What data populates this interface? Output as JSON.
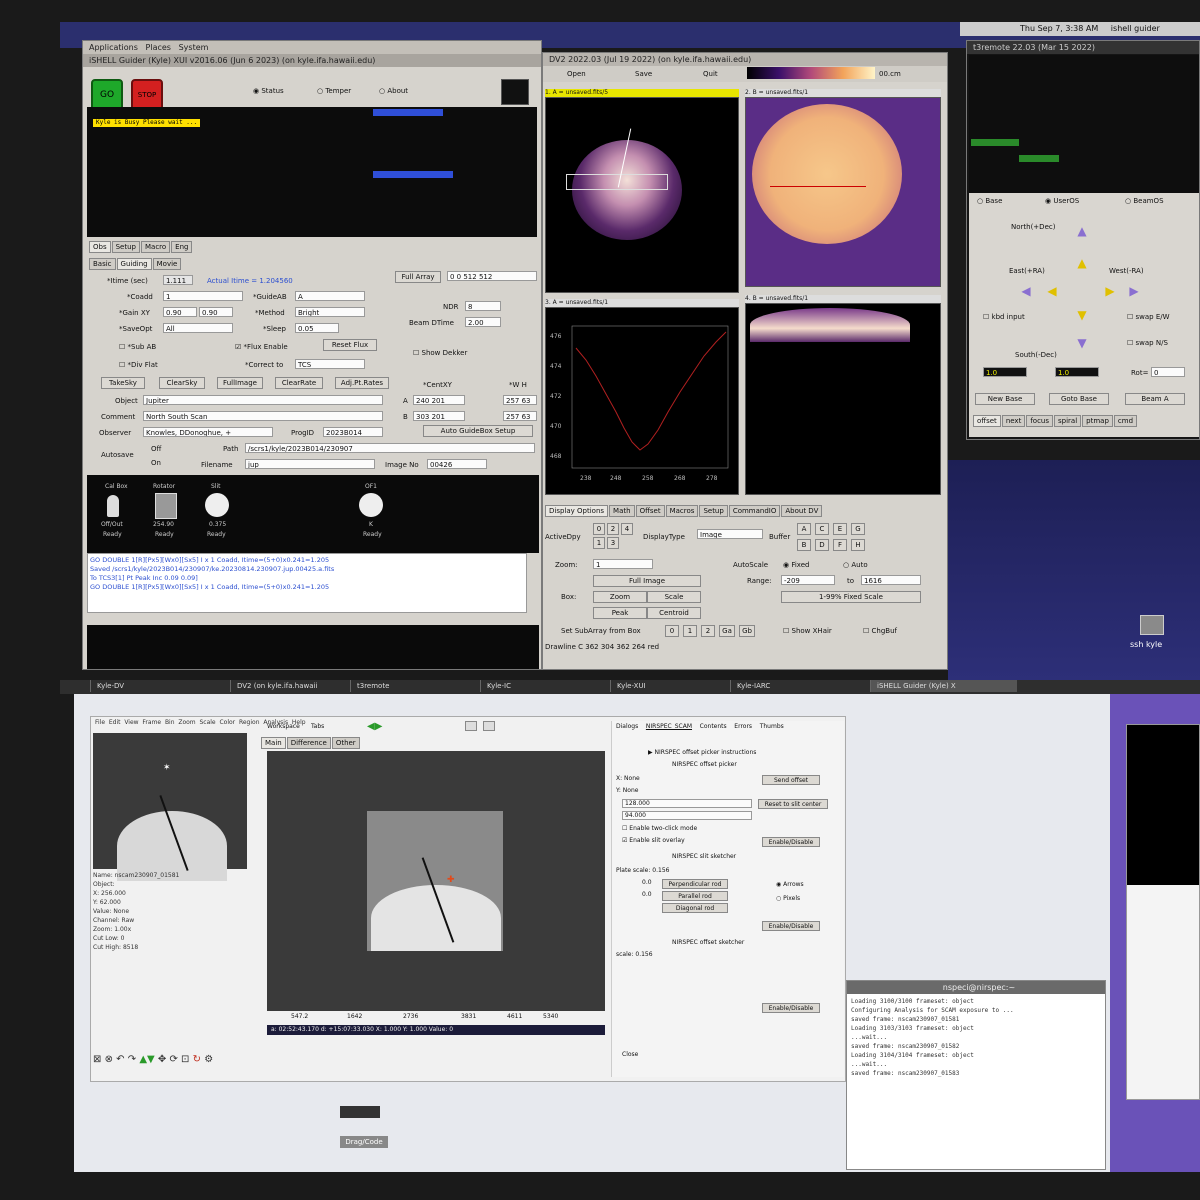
{
  "top_panel": {
    "menu": [
      "Applications",
      "Places",
      "System"
    ],
    "clock": "Thu Sep  7,  3:38 AM",
    "user": "ishell guider"
  },
  "guider": {
    "title": "iSHELL Guider (Kyle) XUI v2016.06 (Jun  6 2023) (on kyle.ifa.hawaii.edu)",
    "go": "GO",
    "stop": "STOP",
    "radio": [
      "Status",
      "Temper",
      "About"
    ],
    "busy": "Kyle is Busy  Please wait ...",
    "tabs": [
      "Obs",
      "Setup",
      "Macro",
      "Eng"
    ],
    "subtabs": [
      "Basic",
      "Guiding",
      "Movie"
    ],
    "itime_label": "*Itime (sec)",
    "itime": "1.111",
    "actual_itime": "Actual Itime = 1.204560",
    "coadd_label": "*Coadd",
    "coadd": "1",
    "guideab_label": "*GuideAB",
    "guideab": "A",
    "gainxy_label": "*Gain XY",
    "gainx": "0.90",
    "gainy": "0.90",
    "method_label": "*Method",
    "method": "Bright",
    "saveopt_label": "*SaveOpt",
    "saveopt": "All",
    "sleep_label": "*Sleep",
    "sleep": "0.05",
    "subab": "*Sub AB",
    "flux_enable": "*Flux Enable",
    "reset_flux": "Reset Flux",
    "divflat": "*Div Flat",
    "correct_label": "*Correct to",
    "correct": "TCS",
    "buttons": [
      "TakeSky",
      "ClearSky",
      "FullImage",
      "ClearRate",
      "Adj.Pt.Rates"
    ],
    "full_array_label": "Full Array",
    "full_array": "0 0 512 512",
    "ndr_label": "NDR",
    "ndr": "8",
    "beam_dtime_label": "Beam DTime",
    "beam_dtime": "2.00",
    "show_dekker": "Show Dekker",
    "centxy_label": "*CentXY",
    "wh_label": "*W H",
    "a_label": "A",
    "a_cent": "240 201",
    "a_wh": "257 63",
    "b_label": "B",
    "b_cent": "303 201",
    "b_wh": "257 63",
    "auto_guidebox": "Auto GuideBox Setup",
    "object_label": "Object",
    "object": "Jupiter",
    "comment_label": "Comment",
    "comment": "North South Scan",
    "observer_label": "Observer",
    "observer": "Knowles, DDonoghue, +",
    "progid_label": "ProgID",
    "progid": "2023B014",
    "autosave_label": "Autosave",
    "autosave_off": "Off",
    "autosave_on": "On",
    "path_label": "Path",
    "path": "/scrs1/kyle/2023B014/230907",
    "filename_label": "Filename",
    "filename": "jup",
    "imageno_label": "Image No",
    "imageno": "00426",
    "mechs": [
      {
        "name": "Cal Box",
        "state": "Off/Out",
        "status": "Ready"
      },
      {
        "name": "Rotator",
        "state": "254.90",
        "status": "Ready"
      },
      {
        "name": "Slit",
        "state": "0.375",
        "status": "Ready"
      },
      {
        "name": "OF1",
        "state": "K",
        "status": "Ready"
      }
    ],
    "log": [
      "GO DOUBLE 1[R][Px5][Wx0][Sx5] I x 1 Coadd, Itime=(5+0)x0.241=1.205",
      "Saved /scrs1/kyle/2023B014/230907/ke.20230814.230907.jup.00425.a.fits",
      "To TCS3[1] Pt Peak Inc 0.09 0.09]",
      "GO DOUBLE 1[R][Px5][Wx0][Sx5] I x 1 Coadd, Itime=(5+0)x0.241=1.205"
    ]
  },
  "dv": {
    "title": "DV2 2022.03 (Jul 19 2022) (on kyle.ifa.hawaii.edu)",
    "menu": [
      "Open",
      "Save",
      "Quit"
    ],
    "zoom_label": "00.cm",
    "buf_a": "1. A = unsaved.fits/5",
    "buf_b": "2. B = unsaved.fits/1",
    "buf_c": "3. A = unsaved.fits/1",
    "buf_d": "4. B = unsaved.fits/1",
    "plot_xticks": [
      "238",
      "248",
      "258",
      "268",
      "278"
    ],
    "plot_yticks": [
      "476",
      "474",
      "472",
      "470",
      "468"
    ],
    "tabs": [
      "Display Options",
      "Math",
      "Offset",
      "Macros",
      "Setup",
      "CommandIO",
      "About DV"
    ],
    "activedpy_label": "ActiveDpy",
    "dpy_nums": [
      "0",
      "1",
      "2",
      "3",
      "4"
    ],
    "displaytype_label": "DisplayType",
    "displaytype": "Image",
    "buffer_label": "Buffer",
    "buffers": [
      "A",
      "C",
      "E",
      "G",
      "B",
      "D",
      "F",
      "H"
    ],
    "zoom_ctl": "Zoom:",
    "zoom_val": "1",
    "autoscale_label": "AutoScale",
    "fixed": "Fixed",
    "auto": "Auto",
    "full_image": "Full Image",
    "range_label": "Range:",
    "range_lo": "-209",
    "range_to": "to",
    "range_hi": "1616",
    "box_label": "Box:",
    "zoom_btn": "Zoom",
    "scale_btn": "Scale",
    "fixed_scale": "1-99% Fixed Scale",
    "peak_btn": "Peak",
    "centroid_btn": "Centroid",
    "subarray": "Set SubArray from Box",
    "sub_nums": [
      "0",
      "1",
      "2",
      "Ga",
      "Gb"
    ],
    "show_xhair": "Show XHair",
    "chgbuf": "ChgBuf",
    "status": "Drawline C 362 304 362 264 red"
  },
  "remote": {
    "title": "t3remote 22.03 (Mar 15 2022)",
    "radios": [
      "Base",
      "UserOS",
      "BeamOS"
    ],
    "north": "North(+Dec)",
    "east": "East(+RA)",
    "west": "West(-RA)",
    "south": "South(-Dec)",
    "kbd": "kbd input",
    "swap_ew": "swap E/W",
    "swap_ns": "swap N/S",
    "inc1": "1.0",
    "inc2": "1.0",
    "rot_label": "Rot=",
    "rot": "0",
    "new_base": "New Base",
    "goto_base": "Goto Base",
    "beam_a": "Beam A",
    "tabs": [
      "offset",
      "next",
      "focus",
      "spiral",
      "ptmap",
      "cmd"
    ]
  },
  "desktop_icon": "ssh kyle",
  "taskbar": [
    "Kyle-DV",
    "DV2 (on kyle.ifa.hawaii",
    "t3remote",
    "Kyle-IC",
    "Kyle-XUI",
    "Kyle-IARC",
    "iSHELL Guider (Kyle) X"
  ],
  "ds9": {
    "menu": [
      "File",
      "Edit",
      "View",
      "Frame",
      "Bin",
      "Zoom",
      "Scale",
      "Color",
      "Region",
      "Analysis",
      "Help"
    ],
    "workspace": "Workspace",
    "tabs_label": "Tabs",
    "subtabs": [
      "Main",
      "Difference",
      "Other"
    ],
    "sideinfo": [
      "Name: nscam230907_01581",
      "Object:",
      "X: 256.000",
      "Y: 62.000",
      "Value: None",
      "Channel: Raw",
      "Zoom: 1.00x",
      "Cut Low: 0",
      "Cut High: 8518"
    ],
    "ruler": [
      "547.2",
      "1642",
      "2736",
      "3831",
      "4611",
      "5340"
    ],
    "coords": "a: 02:52:43.170   d: +15:07:33.030   X: 1.000   Y: 1.000   Value: 0",
    "panel_tabs": [
      "Dialogs",
      "NIRSPEC_SCAM",
      "Contents",
      "Errors",
      "Thumbs"
    ],
    "picker_hdr": "NIRSPEC offset picker instructions",
    "picker": "NIRSPEC offset picker",
    "x_none": "X: None",
    "y_none": "Y: None",
    "x_val": "128.000",
    "y_val": "94.000",
    "send_offset": "Send offset",
    "reset_center": "Reset to slit center",
    "twoclick": "Enable two-click mode",
    "slit_overlay": "Enable slit overlay",
    "enable_disable": "Enable/Disable",
    "slit_sketcher": "NIRSPEC slit sketcher",
    "plate_scale": "Plate scale: 0.156",
    "perp": "Perpendicular rod",
    "parallel": "Parallel rod",
    "diag": "Diagonal rod",
    "p1": "0.0",
    "p2": "0.0",
    "arrows": "Arrows",
    "pixels": "Pixels",
    "offset_sketch": "NIRSPEC offset sketcher",
    "scale": "scale: 0.156",
    "close": "Close"
  },
  "xterm": {
    "title": "nspeci@nirspec:~",
    "lines": [
      "Loading 3100/3100 frameset: object",
      "Configuring Analysis for SCAM exposure to ...",
      "saved frame: nscam230907_01581",
      "Loading 3103/3103 frameset: object",
      "...wait...",
      "saved frame: nscam230907_01582",
      "Loading 3104/3104 frameset: object",
      "...wait...",
      "saved frame: nscam230907_01583"
    ]
  },
  "bottom_bar": "Drag/Code"
}
